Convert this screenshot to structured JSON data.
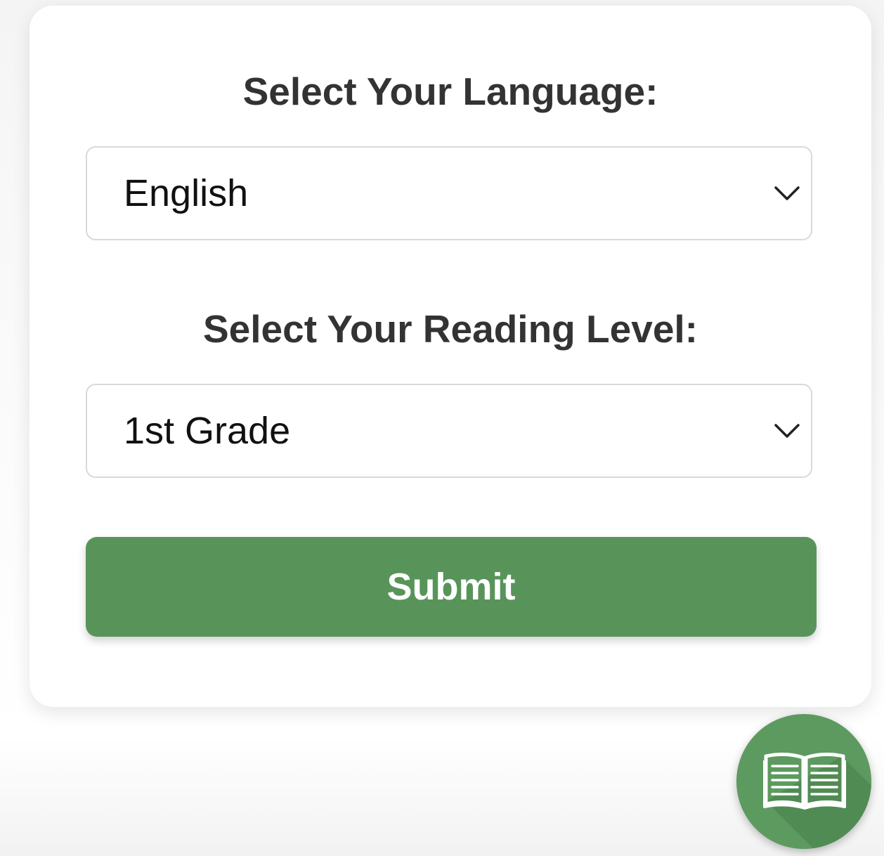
{
  "form": {
    "language_label": "Select Your Language:",
    "language_selected": "English",
    "level_label": "Select Your Reading Level:",
    "level_selected": "1st Grade",
    "submit_label": "Submit"
  },
  "icons": {
    "dropdown": "chevron-down-icon",
    "fab": "open-book-icon"
  },
  "colors": {
    "accent_green": "#58945a",
    "fab_green": "#5d9a5f",
    "text_dark": "#333333"
  }
}
